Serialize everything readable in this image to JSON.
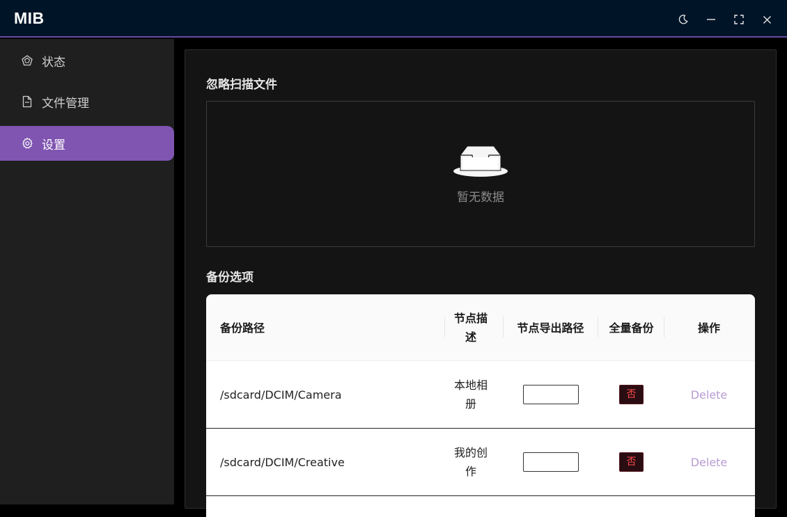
{
  "app": {
    "title": "MIB"
  },
  "window_controls": [
    {
      "name": "theme-toggle-button",
      "icon": "moon-icon"
    },
    {
      "name": "minimize-button",
      "icon": "minimize-icon"
    },
    {
      "name": "fullscreen-button",
      "icon": "fullscreen-icon"
    },
    {
      "name": "close-button",
      "icon": "close-icon"
    }
  ],
  "sidebar": {
    "items": [
      {
        "label": "状态",
        "icon": "dashboard-icon",
        "active": false
      },
      {
        "label": "文件管理",
        "icon": "file-icon",
        "active": false
      },
      {
        "label": "设置",
        "icon": "gear-icon",
        "active": true
      }
    ]
  },
  "ignore_section": {
    "title": "忽略扫描文件",
    "empty_text": "暂无数据",
    "empty_icon": "empty-inbox-icon"
  },
  "backup": {
    "title": "备份选项",
    "headers": {
      "path": "备份路径",
      "desc": "节点描述",
      "export_path": "节点导出路径",
      "full_backup": "全量备份",
      "action": "操作"
    },
    "rows": [
      {
        "path": "/sdcard/DCIM/Camera",
        "desc": "本地相册",
        "export_path": "",
        "full_backup": "否",
        "action": "Delete"
      },
      {
        "path": "/sdcard/DCIM/Creative",
        "desc": "我的创作",
        "export_path": "",
        "full_backup": "否",
        "action": "Delete"
      }
    ]
  },
  "colors": {
    "accent": "#7f55b1",
    "titlebar": "#001428",
    "danger": "#ff4d4f",
    "link": "#b79bd3"
  }
}
